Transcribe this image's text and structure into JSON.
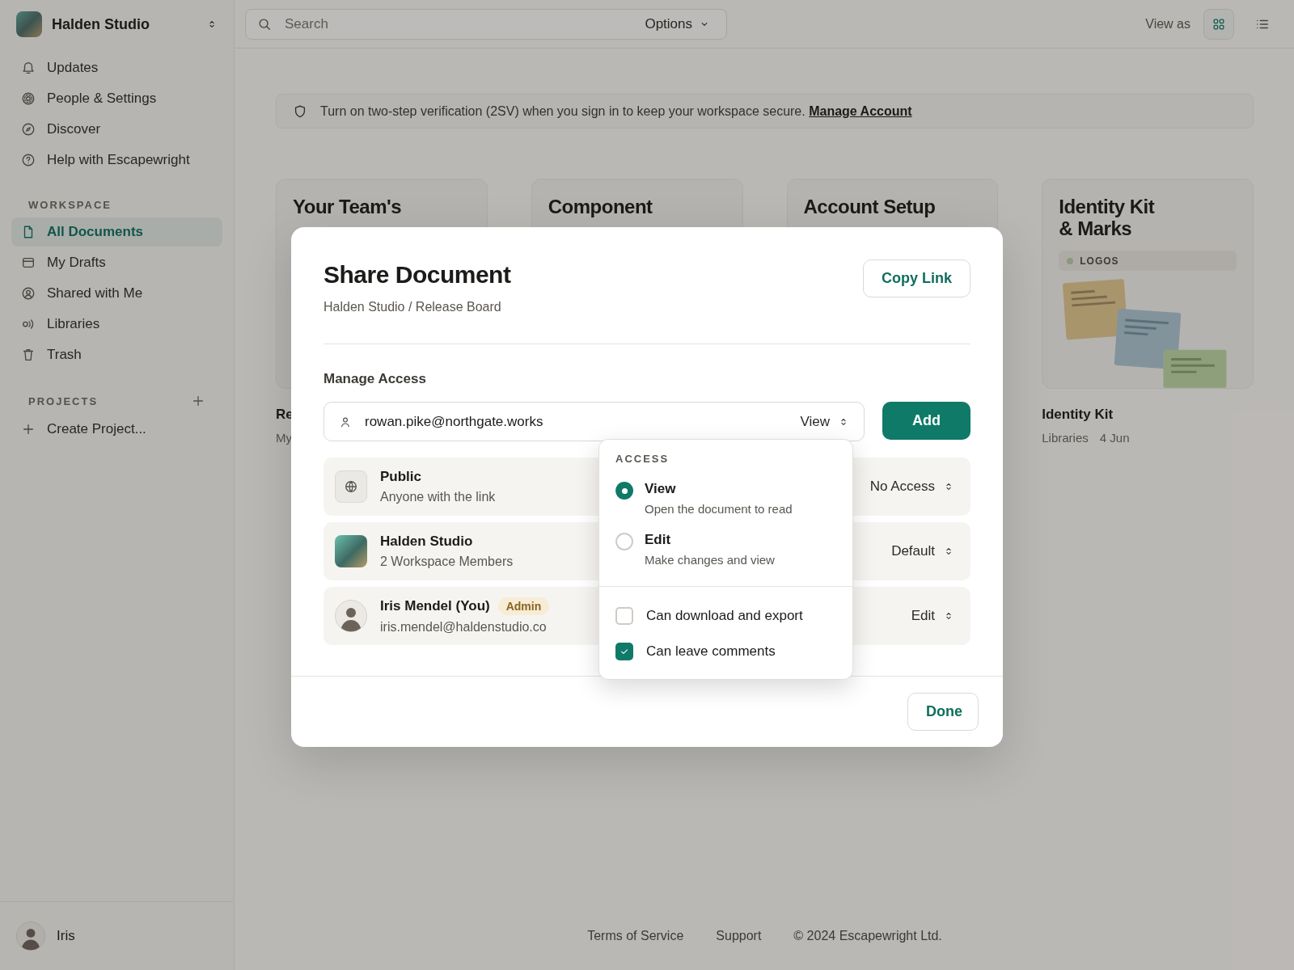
{
  "sidebar": {
    "workspace": "Halden Studio",
    "nav": [
      {
        "label": "Updates"
      },
      {
        "label": "People & Settings"
      },
      {
        "label": "Discover"
      },
      {
        "label": "Help with Escapewright"
      }
    ],
    "workspace_heading": "WORKSPACE",
    "workspace_items": [
      {
        "label": "All Documents",
        "selected": true
      },
      {
        "label": "My Drafts",
        "selected": false
      },
      {
        "label": "Shared with Me",
        "selected": false
      },
      {
        "label": "Libraries",
        "selected": false
      },
      {
        "label": "Trash",
        "selected": false
      }
    ],
    "projects_heading": "PROJECTS",
    "projects_items": [
      {
        "label": "Create Project..."
      }
    ],
    "user": "Iris"
  },
  "topbar": {
    "search_placeholder": "Search",
    "options": "Options",
    "view_as": "View as",
    "views": [
      {
        "selected": true
      },
      {
        "selected": false
      }
    ]
  },
  "banner": {
    "text": "Turn on two-step verification (2SV) when you sign in to keep your workspace secure.",
    "link": "Manage Account"
  },
  "cards": [
    {
      "title": [
        "Your Team's"
      ],
      "name": "Re",
      "meta": [
        "My"
      ]
    },
    {
      "title": [
        "Component"
      ]
    },
    {
      "title": [
        "Account Setup"
      ]
    },
    {
      "title": [
        "Identity Kit",
        "& Marks"
      ],
      "tag": "LOGOS",
      "name": "Identity Kit",
      "meta": [
        "Libraries",
        "4 Jun"
      ]
    }
  ],
  "footer": {
    "links": [
      "Terms of Service",
      "Support"
    ],
    "copyright": "© 2024 Escapewright Ltd."
  },
  "dialog": {
    "title": "Share Document",
    "breadcrumb": "Halden Studio / Release Board",
    "copy_link": "Copy Link",
    "section": "Manage Access",
    "invite": {
      "value": "rowan.pike@northgate.works",
      "role": "View"
    },
    "add": "Add",
    "members": [
      {
        "kind": "public",
        "name": "Public",
        "subtitle": "Anyone with the link",
        "access": "No Access"
      },
      {
        "kind": "workspace",
        "name": "Halden Studio",
        "subtitle": "2 Workspace Members",
        "access": "Default"
      },
      {
        "kind": "person",
        "name": "Iris Mendel (You)",
        "badge": "Admin",
        "subtitle": "iris.mendel@haldenstudio.co",
        "access": "Edit"
      }
    ],
    "done": "Done"
  },
  "access_menu": {
    "heading": "ACCESS",
    "options": [
      {
        "label": "View",
        "description": "Open the document to read",
        "selected": true
      },
      {
        "label": "Edit",
        "description": "Make changes and view",
        "selected": false
      }
    ],
    "permissions": [
      {
        "label": "Can download and export",
        "checked": false
      },
      {
        "label": "Can leave comments",
        "checked": true
      }
    ]
  }
}
